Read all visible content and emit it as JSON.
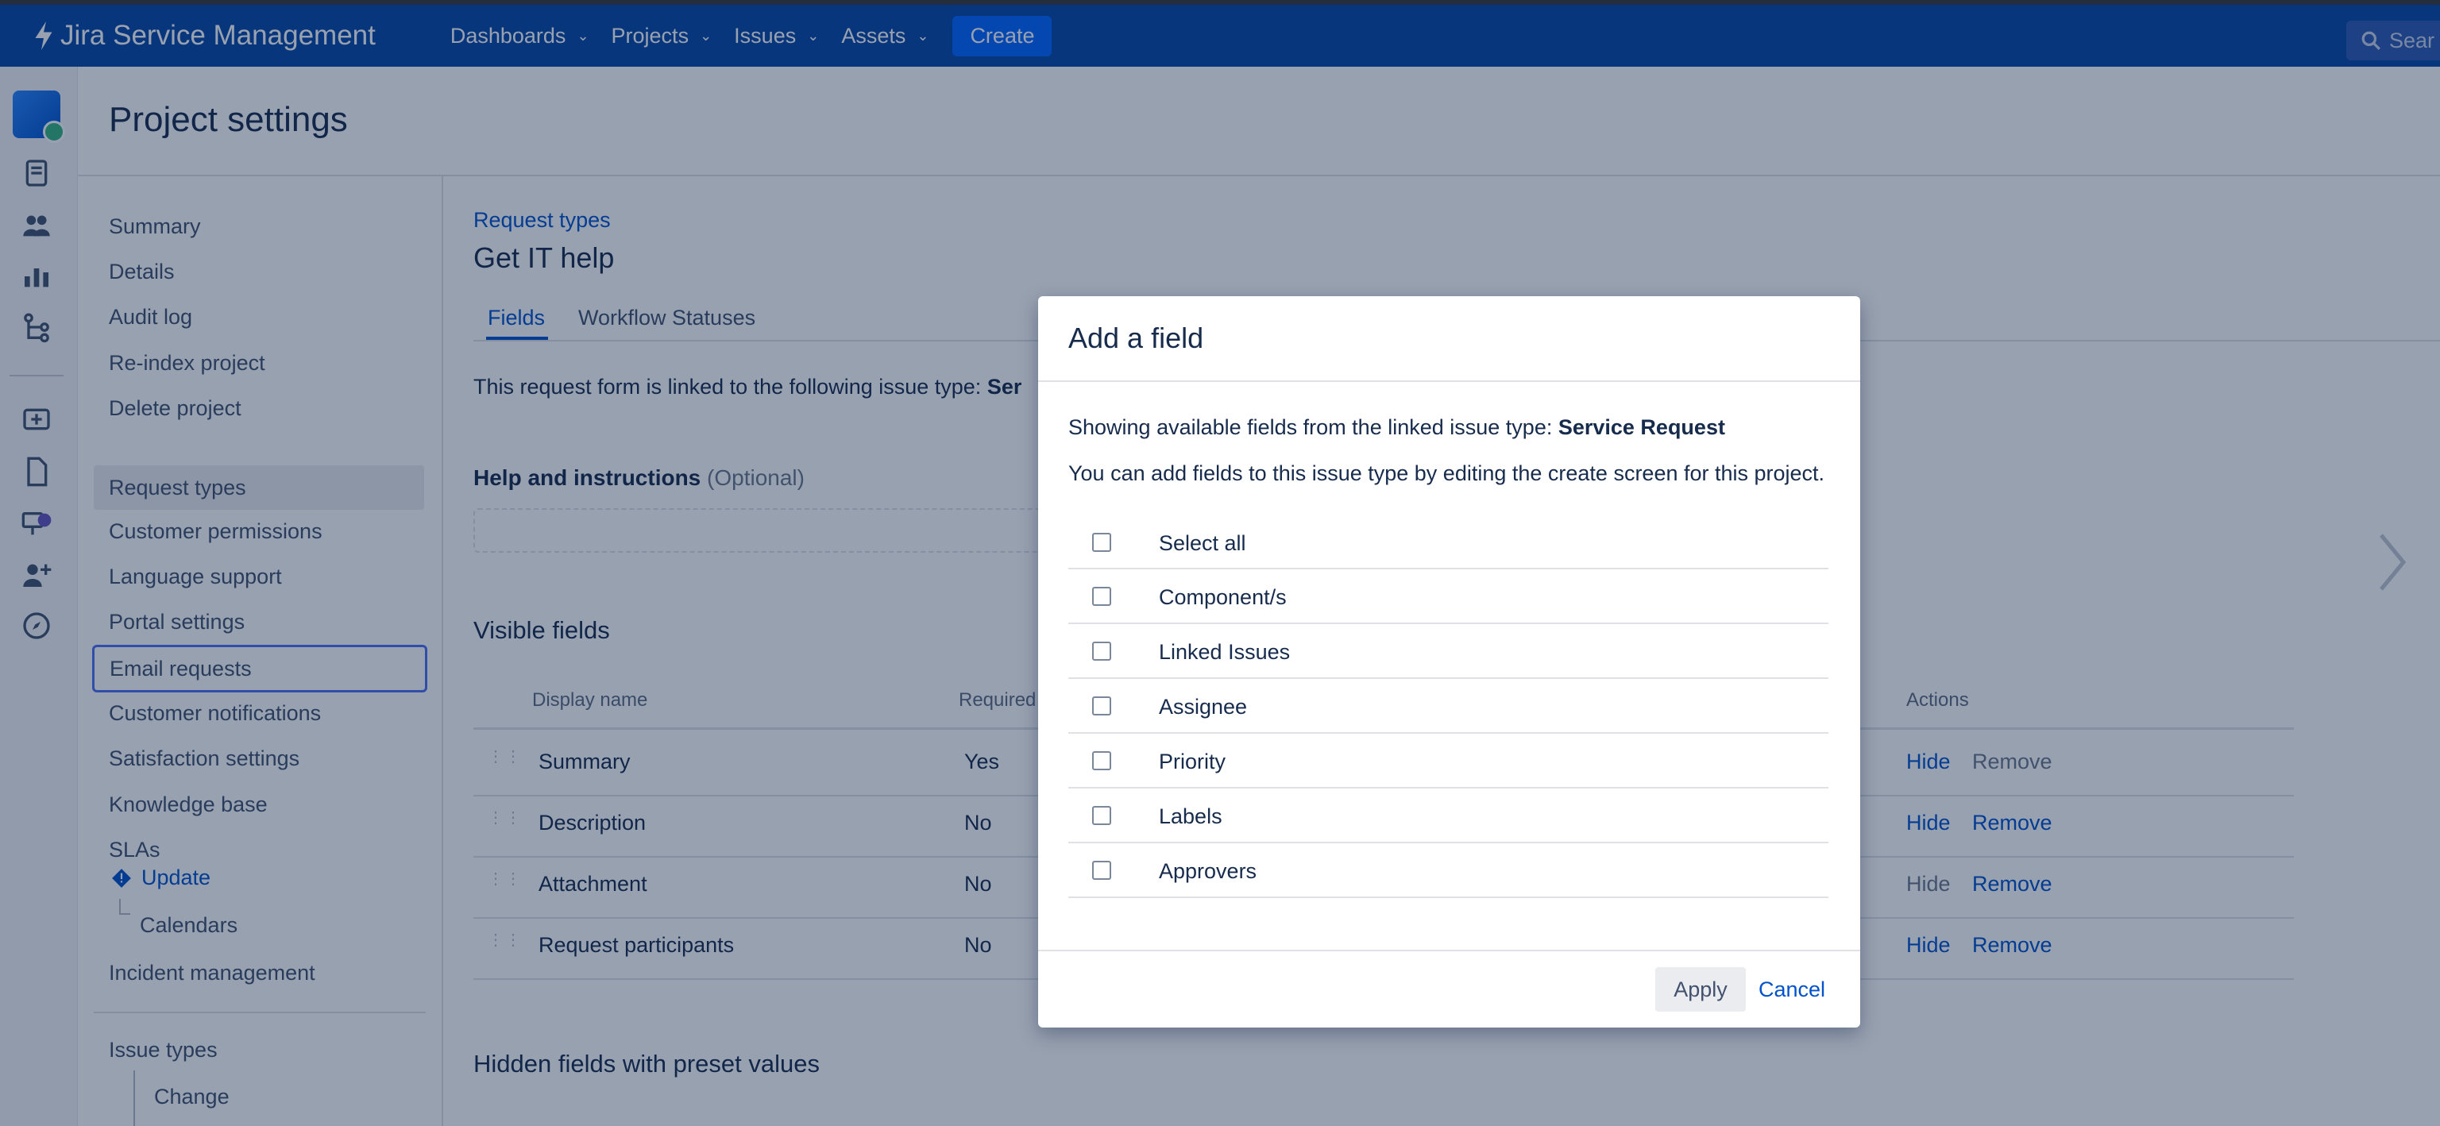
{
  "topnav": {
    "brand": "Jira Service Management",
    "menus": [
      "Dashboards",
      "Projects",
      "Issues",
      "Assets"
    ],
    "create_label": "Create",
    "search_placeholder": "Sear"
  },
  "header": {
    "title": "Project settings"
  },
  "sidebar": {
    "group1": [
      "Summary",
      "Details",
      "Audit log",
      "Re-index project",
      "Delete project"
    ],
    "group2": [
      "Request types",
      "Customer permissions",
      "Language support",
      "Portal settings",
      "Email requests",
      "Customer notifications",
      "Satisfaction settings",
      "Knowledge base",
      "SLAs"
    ],
    "sla_update": "Update",
    "calendars": "Calendars",
    "incident": "Incident management",
    "issue_types": "Issue types",
    "change": "Change",
    "selected": "Request types",
    "focused": "Email requests"
  },
  "main": {
    "breadcrumb": "Request types",
    "title": "Get IT help",
    "tabs": [
      "Fields",
      "Workflow Statuses"
    ],
    "linked_text": "This request form is linked to the following issue type: ",
    "linked_type_partial": "Ser",
    "help_label": "Help and instructions",
    "help_optional": "(Optional)",
    "visible_fields_title": "Visible fields",
    "columns": {
      "display_name": "Display name",
      "required": "Required",
      "actions": "Actions"
    },
    "rows": [
      {
        "name": "Summary",
        "required": "Yes",
        "hide": "Hide",
        "remove": "Remove",
        "hide_active": true,
        "remove_active": false
      },
      {
        "name": "Description",
        "required": "No",
        "hide": "Hide",
        "remove": "Remove",
        "hide_active": true,
        "remove_active": true
      },
      {
        "name": "Attachment",
        "required": "No",
        "hide": "Hide",
        "remove": "Remove",
        "hide_active": false,
        "remove_active": true
      },
      {
        "name": "Request participants",
        "required": "No",
        "hide": "Hide",
        "remove": "Remove",
        "hide_active": true,
        "remove_active": true
      }
    ],
    "hidden_fields_title": "Hidden fields with preset values"
  },
  "modal": {
    "title": "Add a field",
    "intro_prefix": "Showing available fields from the linked issue type: ",
    "intro_type": "Service Request",
    "note": "You can add fields to this issue type by editing the create screen for this project.",
    "select_all": "Select all",
    "fields": [
      "Component/s",
      "Linked Issues",
      "Assignee",
      "Priority",
      "Labels",
      "Approvers"
    ],
    "apply": "Apply",
    "cancel": "Cancel"
  },
  "colors": {
    "nav": "#0747a6",
    "link": "#0052cc",
    "create": "#0065ff"
  }
}
